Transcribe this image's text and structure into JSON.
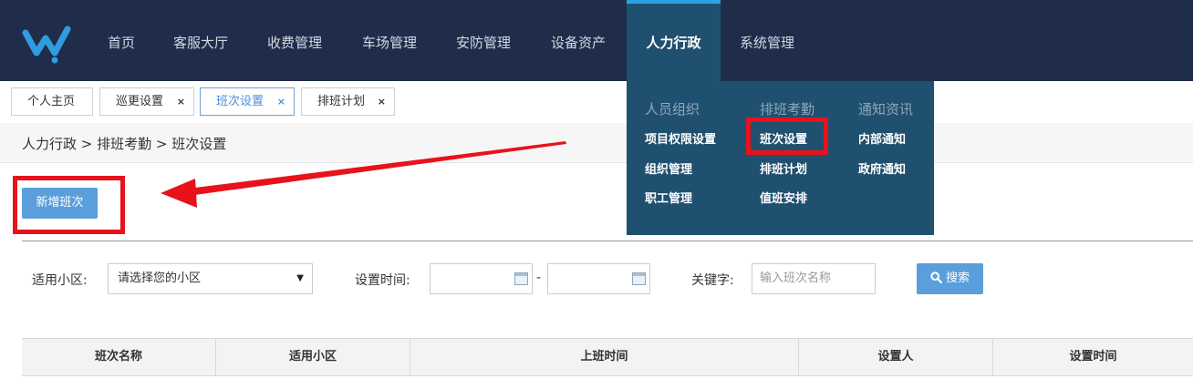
{
  "nav": {
    "items": [
      "首页",
      "客服大厅",
      "收费管理",
      "车场管理",
      "安防管理",
      "设备资产",
      "人力行政",
      "系统管理"
    ],
    "active_index": 6
  },
  "tabs": [
    {
      "label": "个人主页",
      "closable": false,
      "active": false
    },
    {
      "label": "巡更设置",
      "closable": true,
      "active": false
    },
    {
      "label": "班次设置",
      "closable": true,
      "active": true
    },
    {
      "label": "排班计划",
      "closable": true,
      "active": false
    }
  ],
  "close_glyph": "×",
  "breadcrumb": "人力行政 > 排班考勤 > 班次设置",
  "toolbar": {
    "add_label": "新增班次"
  },
  "filters": {
    "community_label": "适用小区:",
    "community_value": "请选择您的小区",
    "time_label": "设置时间:",
    "time_separator": "-",
    "keyword_label": "关键字:",
    "keyword_placeholder": "输入班次名称",
    "search_label": "搜索"
  },
  "table": {
    "columns": [
      "班次名称",
      "适用小区",
      "上班时间",
      "设置人",
      "设置时间"
    ]
  },
  "dropdown": {
    "columns": [
      {
        "title": "人员组织",
        "items": [
          "项目权限设置",
          "组织管理",
          "职工管理"
        ]
      },
      {
        "title": "排班考勤",
        "items": [
          "班次设置",
          "排班计划",
          "值班安排"
        ]
      },
      {
        "title": "通知资讯",
        "items": [
          "内部通知",
          "政府通知"
        ]
      }
    ]
  },
  "icons": {
    "logo": "logo-icon",
    "search": "search-icon",
    "calendar": "calendar-icon",
    "caret": "caret-down-icon",
    "close": "close-icon"
  },
  "colors": {
    "nav_bg": "#1f2d4a",
    "nav_active_bg": "#20506f",
    "accent": "#5a9fdc",
    "highlight": "#e8121b"
  }
}
